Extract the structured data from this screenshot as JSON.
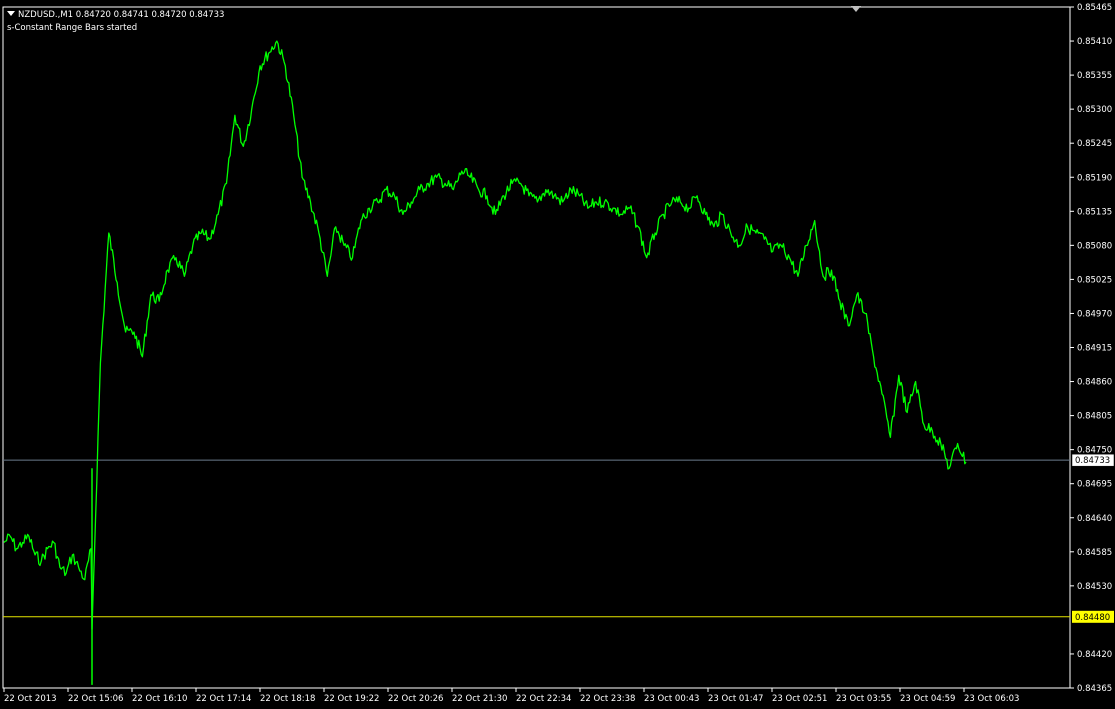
{
  "header": {
    "symbol_line": "NZDUSD.,M1  0.84720 0.84741 0.84720 0.84733",
    "indicator_line": "s-Constant Range Bars started"
  },
  "colors": {
    "background": "#000000",
    "price_line": "#00ff00",
    "grid_frame": "#ffffff",
    "bid_line": "#6b7b8c",
    "level_line": "#e6e600",
    "bid_tag_bg": "#ffffff",
    "level_tag_bg": "#ffff00"
  },
  "chart_data": {
    "type": "line",
    "series": [
      {
        "values": [
          0.846,
          0.8461,
          0.8459,
          0.846,
          0.8461,
          0.8458,
          0.8457,
          0.8459,
          0.846,
          0.8456,
          0.8455,
          0.8458,
          0.8456,
          0.8454,
          0.8459,
          0.8446,
          0.8489,
          0.851,
          0.8502,
          0.8494,
          0.8494,
          0.849,
          0.85,
          0.8499,
          0.8504,
          0.8506,
          0.8503,
          0.8508,
          0.851,
          0.8509,
          0.8513,
          0.8518,
          0.8529,
          0.8524,
          0.853,
          0.8537,
          0.8539,
          0.8541,
          0.8537,
          0.8529,
          0.8519,
          0.8515,
          0.851,
          0.8503,
          0.8511,
          0.8508,
          0.8506,
          0.8512,
          0.8514,
          0.8515,
          0.8517,
          0.8516,
          0.8513,
          0.8515,
          0.8517,
          0.8518,
          0.8519,
          0.8518,
          0.8517,
          0.852,
          0.8519,
          0.8517,
          0.8516,
          0.8513,
          0.8516,
          0.8518,
          0.8518,
          0.8516,
          0.8515,
          0.8517,
          0.8516,
          0.8515,
          0.8517,
          0.8516,
          0.8514,
          0.8515,
          0.8515,
          0.8514,
          0.8513,
          0.8514,
          0.8511,
          0.8506,
          0.851,
          0.8513,
          0.8515,
          0.8515,
          0.8514,
          0.8516,
          0.8513,
          0.8511,
          0.8513,
          0.851,
          0.8508,
          0.8511,
          0.851,
          0.8509,
          0.8507,
          0.8508,
          0.8506,
          0.8503,
          0.8508,
          0.8512,
          0.8503,
          0.8504,
          0.8499,
          0.8495,
          0.85,
          0.8497,
          0.849,
          0.8484,
          0.8477,
          0.8487,
          0.8481,
          0.8486,
          0.8479,
          0.8478,
          0.8476,
          0.8472,
          0.8476,
          0.8473
        ],
        "first_value": 0.846,
        "last_value": 0.84733
      }
    ],
    "y_ticks": [
      "0.85465",
      "0.85410",
      "0.85355",
      "0.85300",
      "0.85245",
      "0.85190",
      "0.85135",
      "0.85080",
      "0.85025",
      "0.84970",
      "0.84915",
      "0.84860",
      "0.84805",
      "0.84750",
      "0.84695",
      "0.84640",
      "0.84585",
      "0.84530",
      "0.84420",
      "0.84365"
    ],
    "x_ticks": [
      "22 Oct 2013",
      "22 Oct 15:06",
      "22 Oct 16:10",
      "22 Oct 17:14",
      "22 Oct 18:18",
      "22 Oct 19:22",
      "22 Oct 20:26",
      "22 Oct 21:30",
      "22 Oct 22:34",
      "22 Oct 23:38",
      "23 Oct 00:43",
      "23 Oct 01:47",
      "23 Oct 02:51",
      "23 Oct 03:55",
      "23 Oct 04:59",
      "23 Oct 06:03"
    ],
    "ylim": [
      0.84365,
      0.85465
    ],
    "horizontal_lines": [
      {
        "label": "0.84733",
        "value": 0.84733,
        "role": "bid"
      },
      {
        "label": "0.84480",
        "value": 0.8448,
        "role": "level"
      }
    ],
    "grid": false,
    "legend": "none"
  }
}
